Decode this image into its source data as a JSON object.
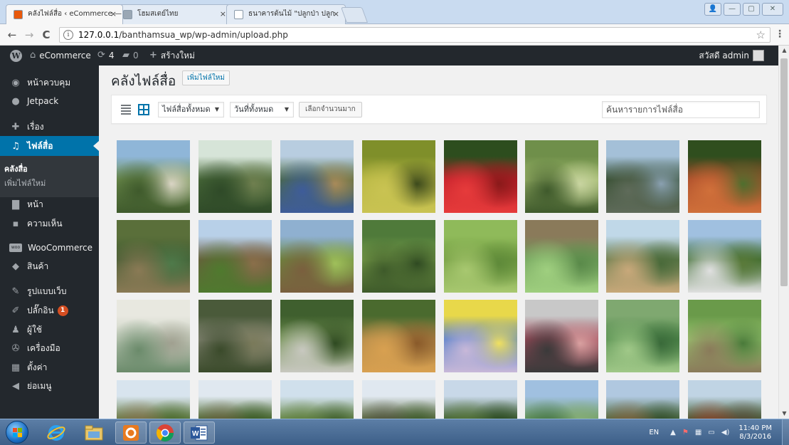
{
  "browser": {
    "tabs": [
      {
        "title": "คลังไฟล์สื่อ ‹ eCommerce —",
        "favicon_color": "#e8590c",
        "active": true
      },
      {
        "title": "โฮมสเตย์ไทย",
        "favicon_color": "#9aa7b4",
        "active": false
      },
      {
        "title": "ธนาคารต้นไม้ \"ปลูกป่า ปลูก",
        "favicon_color": "#ffffff",
        "active": false
      }
    ],
    "tab_close_glyph": "×",
    "window_controls": {
      "user": "👤",
      "minimize": "—",
      "maximize": "▢",
      "close": "✕"
    },
    "nav": {
      "back": "←",
      "forward": "→",
      "reload": "C"
    },
    "address": {
      "host": "127.0.0.1",
      "path": "/banthamsua_wp/wp-admin/upload.php",
      "info_glyph": "i"
    },
    "star_glyph": "☆",
    "menu_glyph": "⋮"
  },
  "adminbar": {
    "site_name": "eCommerce",
    "updates_count": "4",
    "comments_count": "0",
    "new_label": "สร้างใหม่",
    "greeting": "สวัสดี admin"
  },
  "sidebar": {
    "items": [
      {
        "label": "หน้าควบคุม",
        "icon": "dashboard-icon",
        "glyph": "◉"
      },
      {
        "label": "Jetpack",
        "icon": "jetpack-icon",
        "glyph": "●"
      },
      {
        "label": "เรื่อง",
        "icon": "pin-icon",
        "glyph": "✚"
      },
      {
        "label": "ไฟล์สื่อ",
        "icon": "media-icon",
        "glyph": "♫"
      },
      {
        "label": "หน้า",
        "icon": "page-icon",
        "glyph": "▇"
      },
      {
        "label": "ความเห็น",
        "icon": "comment-icon",
        "glyph": "▪"
      },
      {
        "label": "WooCommerce",
        "icon": "woo-icon",
        "glyph": "woo"
      },
      {
        "label": "สินค้า",
        "icon": "product-icon",
        "glyph": "◆"
      },
      {
        "label": "รูปแบบเว็บ",
        "icon": "appearance-icon",
        "glyph": "✎"
      },
      {
        "label": "ปลั๊กอิน",
        "icon": "plugin-icon",
        "glyph": "✐",
        "badge": "1"
      },
      {
        "label": "ผู้ใช้",
        "icon": "users-icon",
        "glyph": "♟"
      },
      {
        "label": "เครื่องมือ",
        "icon": "tools-icon",
        "glyph": "✇"
      },
      {
        "label": "ตั้งค่า",
        "icon": "settings-icon",
        "glyph": "▦"
      },
      {
        "label": "ย่อเมนู",
        "icon": "collapse-icon",
        "glyph": "◀"
      }
    ],
    "submenu": [
      "คลังสื่อ",
      "เพิ่มไฟล์ใหม่"
    ]
  },
  "main": {
    "title": "คลังไฟล์สื่อ",
    "add_new": "เพิ่มไฟล์ใหม่",
    "filter_type": "ไฟล์สื่อทั้งหมด",
    "filter_date": "วันที่ทั้งหมด",
    "bulk_select": "เลือกจำนวนมาก",
    "search_placeholder": "ค้นหารายการไฟล์สื่อ",
    "select_caret": "▼"
  },
  "media_items": [
    {
      "name": "riverside-picnic-tables",
      "colors": [
        "#8fb6d8",
        "#6f8f4e",
        "#3f5a2c",
        "#d9d4c4"
      ]
    },
    {
      "name": "lake-with-trees",
      "colors": [
        "#d6e4d8",
        "#4a6b3a",
        "#2f4a28",
        "#6f7f4f"
      ]
    },
    {
      "name": "garden-with-shelter",
      "colors": [
        "#b8cde0",
        "#4d6b3c",
        "#3e5c9a",
        "#a88a5a"
      ]
    },
    {
      "name": "durians",
      "colors": [
        "#7f8f2a",
        "#b7b743",
        "#c9c352",
        "#3d4a1c"
      ]
    },
    {
      "name": "rambutans",
      "colors": [
        "#2d4d1e",
        "#c01e2a",
        "#e63b3b",
        "#8a1a1a"
      ]
    },
    {
      "name": "woman-under-tree",
      "colors": [
        "#6f8f4a",
        "#9fb86a",
        "#3f5a2c",
        "#c8d4a0"
      ]
    },
    {
      "name": "river-rafting",
      "colors": [
        "#a4c0d8",
        "#2f4a2a",
        "#5f6b5a",
        "#8aa0b0"
      ]
    },
    {
      "name": "rambutan-tree",
      "colors": [
        "#2f4e1e",
        "#a84a2a",
        "#d0703a",
        "#4f6f2e"
      ]
    },
    {
      "name": "melon-in-field",
      "colors": [
        "#5a6f3a",
        "#3f5a30",
        "#8a7a55",
        "#4f7a4a"
      ]
    },
    {
      "name": "tree-seedlings",
      "colors": [
        "#b8d0e8",
        "#6b5a3e",
        "#4f7a2e",
        "#8a6f4a"
      ]
    },
    {
      "name": "vegetable-rows",
      "colors": [
        "#8fb0d0",
        "#6b8a3e",
        "#7a5f3e",
        "#9fbf5a"
      ]
    },
    {
      "name": "leafy-plant",
      "colors": [
        "#4f7a3a",
        "#7aa04a",
        "#3e5a2a",
        "#2f4a22"
      ]
    },
    {
      "name": "grass-patch",
      "colors": [
        "#8fba5a",
        "#6f9a3e",
        "#a8c870",
        "#5f8a3a"
      ]
    },
    {
      "name": "tobacco-plant",
      "colors": [
        "#8a7a5a",
        "#6f9f5a",
        "#9fcf7f",
        "#5a8a4a"
      ]
    },
    {
      "name": "village-path",
      "colors": [
        "#c0d8e8",
        "#5f7a4a",
        "#c8a87a",
        "#4a6a3a"
      ]
    },
    {
      "name": "signboard-garden",
      "colors": [
        "#a0c0e0",
        "#3a6a2e",
        "#e0e0e0",
        "#5a7a3a"
      ]
    },
    {
      "name": "hand-drawn-map",
      "colors": [
        "#e8e8e0",
        "#c8d0c0",
        "#6a8a6a",
        "#a0a090"
      ]
    },
    {
      "name": "stone-sign-forest",
      "colors": [
        "#4a5a3a",
        "#8a8a7a",
        "#3a4a2a",
        "#7a7a5a"
      ]
    },
    {
      "name": "forest-homestay-sign",
      "colors": [
        "#3f5f2e",
        "#6f8f4e",
        "#c8c8c0",
        "#2f4a22"
      ]
    },
    {
      "name": "baskets-and-honey",
      "colors": [
        "#4a6a2e",
        "#b08a4a",
        "#d8a050",
        "#8a5a2a"
      ]
    },
    {
      "name": "t-shirts",
      "colors": [
        "#e8d84a",
        "#4a7ac8",
        "#c8b8d8",
        "#f0e060"
      ]
    },
    {
      "name": "packaged-product",
      "colors": [
        "#c8c8c8",
        "#a04a5a",
        "#3a3a3a",
        "#d8a0a0"
      ]
    },
    {
      "name": "tobacco-leaves",
      "colors": [
        "#7fa870",
        "#4f8a4a",
        "#a0c888",
        "#3a6a3a"
      ]
    },
    {
      "name": "big-leaf-plant",
      "colors": [
        "#6a9a4a",
        "#9ac870",
        "#8a7a5a",
        "#4a7a3a"
      ]
    },
    {
      "name": "field-row-1",
      "colors": [
        "#d8e4ee",
        "#5f7a3e",
        "#8a6a4a",
        "#4a6a2e"
      ]
    },
    {
      "name": "field-row-2",
      "colors": [
        "#e0e8f0",
        "#4a6a2e",
        "#6a5a3e",
        "#3a5a26"
      ]
    },
    {
      "name": "field-row-3",
      "colors": [
        "#d0e0ec",
        "#6a8a4a",
        "#5a7a3a",
        "#3a5a2a"
      ]
    },
    {
      "name": "palm-field",
      "colors": [
        "#e0e8f0",
        "#5a6a3e",
        "#4a4a3a",
        "#3a5a2a"
      ]
    },
    {
      "name": "palm-trees",
      "colors": [
        "#c8d8e8",
        "#3a5a2a",
        "#5a7a3a",
        "#2a4a22"
      ]
    },
    {
      "name": "green-house",
      "colors": [
        "#a0c0e0",
        "#6a9a5a",
        "#3a6a3e",
        "#8ab07a"
      ]
    },
    {
      "name": "village-hut",
      "colors": [
        "#b0c8e0",
        "#4a6a3a",
        "#8a5a3a",
        "#2f4a2a"
      ]
    },
    {
      "name": "red-house",
      "colors": [
        "#c0d4e4",
        "#3a5a2a",
        "#a03a2a",
        "#5a4a3a"
      ]
    }
  ],
  "taskbar": {
    "language": "EN",
    "time": "11:40 PM",
    "date": "8/3/2016",
    "tray_glyphs": [
      "▲",
      "⚑",
      "▦",
      "▭",
      "◀)"
    ]
  }
}
